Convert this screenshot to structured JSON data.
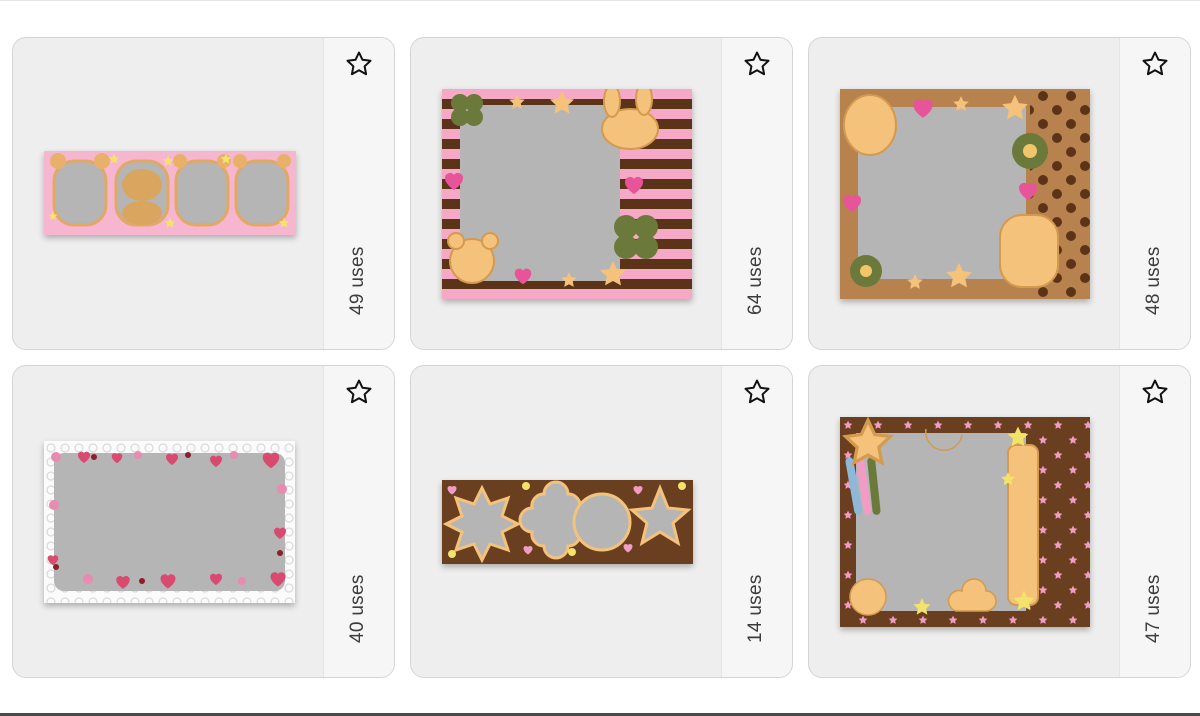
{
  "grid": {
    "cards": [
      {
        "uses_label": "49 uses",
        "theme": "pink-bears-strip",
        "bg": "#f7b6cf",
        "accent": "#f2c27c"
      },
      {
        "uses_label": "64 uses",
        "theme": "pink-brown-stripes",
        "bg": "#f5a9c6",
        "accent": "#5b3318"
      },
      {
        "uses_label": "48 uses",
        "theme": "brown-polka-dots",
        "bg": "#b8824f",
        "accent": "#5b3318"
      },
      {
        "uses_label": "40 uses",
        "theme": "lace-hearts",
        "bg": "#f3f3f3",
        "accent": "#d94a6f"
      },
      {
        "uses_label": "14 uses",
        "theme": "brown-shapes-strip",
        "bg": "#6a3f1f",
        "accent": "#f2c27c"
      },
      {
        "uses_label": "47 uses",
        "theme": "brown-pink-stars",
        "bg": "#6a3f1f",
        "accent": "#f2c27c"
      }
    ]
  },
  "icons": {
    "favorite": "star-outline-icon"
  },
  "colors": {
    "card_bg": "#eeeeee",
    "side_bg": "#f6f6f6",
    "photo_slot": "#b5b5b5",
    "cookie": "#f4c27a",
    "cookie_edge": "#d49a4e"
  }
}
